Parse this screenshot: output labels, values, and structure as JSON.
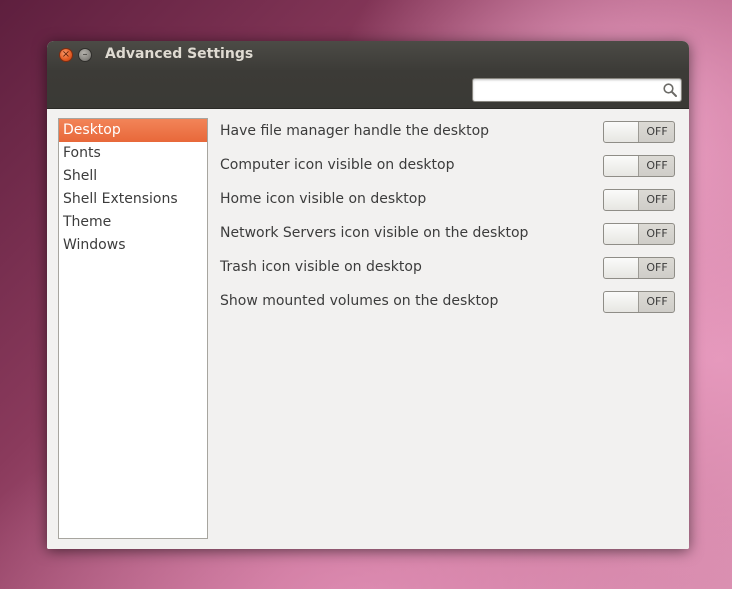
{
  "window": {
    "title": "Advanced Settings",
    "close_glyph": "×",
    "minimize_glyph": "–"
  },
  "search": {
    "value": "",
    "placeholder": "",
    "icon": "search-icon"
  },
  "sidebar": {
    "items": [
      {
        "label": "Desktop",
        "selected": true
      },
      {
        "label": "Fonts",
        "selected": false
      },
      {
        "label": "Shell",
        "selected": false
      },
      {
        "label": "Shell Extensions",
        "selected": false
      },
      {
        "label": "Theme",
        "selected": false
      },
      {
        "label": "Windows",
        "selected": false
      }
    ]
  },
  "settings": [
    {
      "label": "Have file manager handle the desktop",
      "state": "OFF"
    },
    {
      "label": "Computer icon visible on desktop",
      "state": "OFF"
    },
    {
      "label": "Home icon visible on desktop",
      "state": "OFF"
    },
    {
      "label": "Network Servers icon visible on the desktop",
      "state": "OFF"
    },
    {
      "label": "Trash icon visible on desktop",
      "state": "OFF"
    },
    {
      "label": "Show mounted volumes on the desktop",
      "state": "OFF"
    }
  ],
  "colors": {
    "accent": "#e8683a",
    "titlebar": "#3c3b37",
    "window_bg": "#f2f1f0"
  }
}
